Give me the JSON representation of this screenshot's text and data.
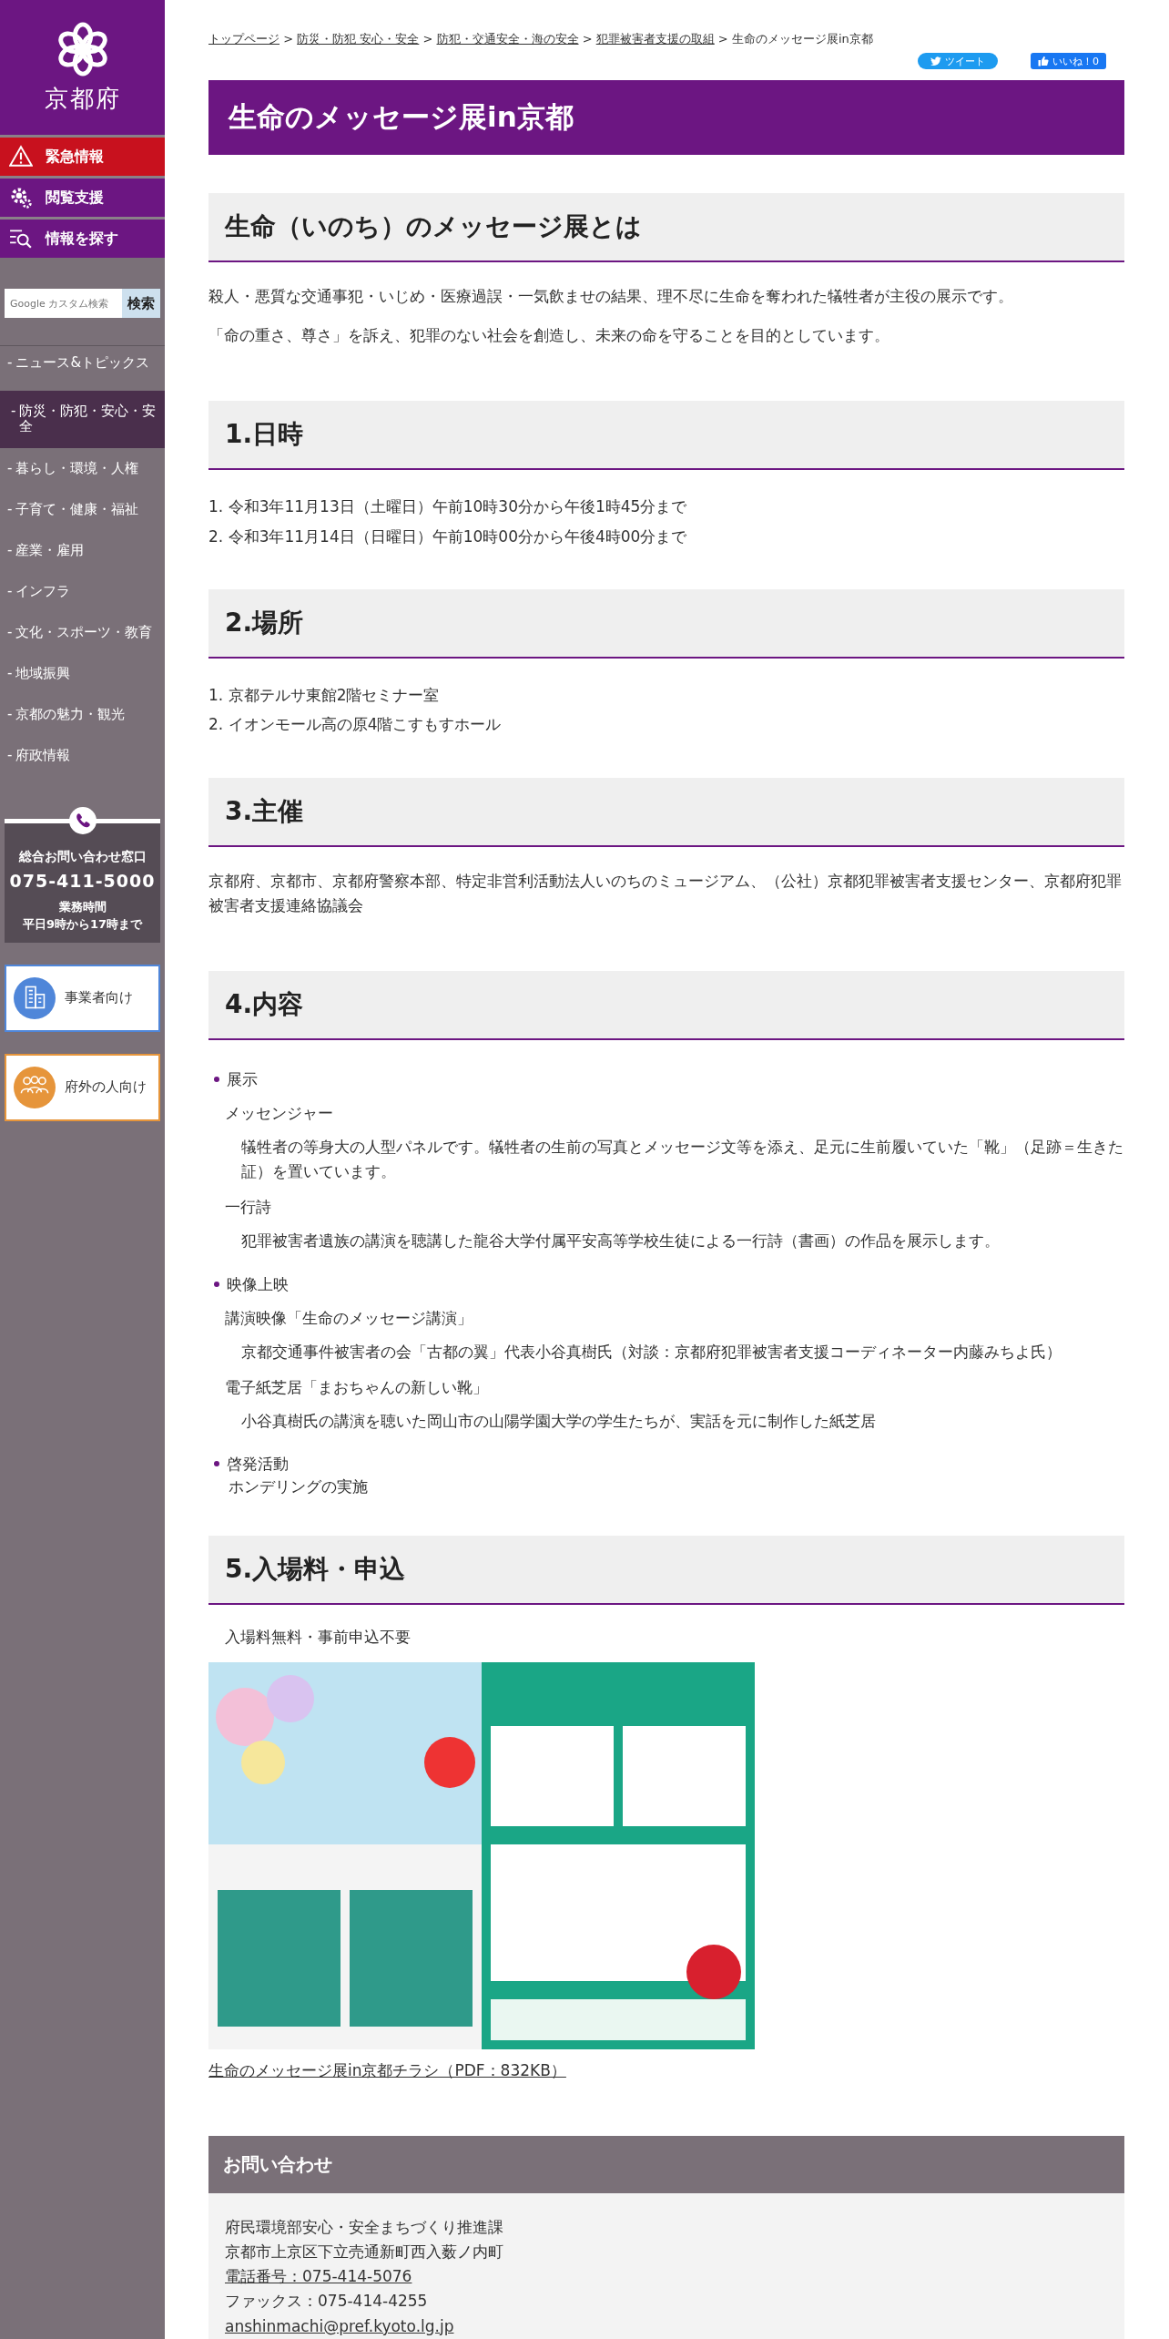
{
  "logo": {
    "text": "京都府"
  },
  "top_menu": [
    {
      "label": "緊急情報",
      "kind": "alert"
    },
    {
      "label": "閲覧支援",
      "kind": "gear"
    },
    {
      "label": "情報を探す",
      "kind": "search"
    }
  ],
  "search": {
    "placeholder": "Google カスタム検索",
    "button": "検索"
  },
  "nav": [
    {
      "label": "ニュース&トピックス",
      "selected": false
    },
    {
      "label": "防災・防犯・安心・安全",
      "selected": true
    },
    {
      "label": "暮らし・環境・人権",
      "selected": false
    },
    {
      "label": "子育て・健康・福祉",
      "selected": false
    },
    {
      "label": "産業・雇用",
      "selected": false
    },
    {
      "label": "インフラ",
      "selected": false
    },
    {
      "label": "文化・スポーツ・教育",
      "selected": false
    },
    {
      "label": "地域振興",
      "selected": false
    },
    {
      "label": "京都の魅力・観光",
      "selected": false
    },
    {
      "label": "府政情報",
      "selected": false
    }
  ],
  "nav_dash": "-",
  "contact_box": {
    "title": "総合お問い合わせ窓口",
    "phone": "075-411-5000",
    "hours_label": "業務時間",
    "hours": "平日9時から17時まで"
  },
  "audience_links": [
    {
      "label": "事業者向け",
      "kind": "business",
      "color": "#4f86d9"
    },
    {
      "label": "府外の人向け",
      "kind": "people",
      "color": "#e6953b"
    }
  ],
  "breadcrumb": {
    "separator": ">",
    "links": [
      "トップページ",
      "防災・防犯 安心・安全",
      "防犯・交通安全・海の安全",
      "犯罪被害者支援の取組"
    ],
    "current": "生命のメッセージ展in京都"
  },
  "social": [
    {
      "label": "ツイート",
      "kind": "tweet"
    },
    {
      "label": "いいね！0",
      "kind": "like"
    }
  ],
  "page_title": "生命のメッセージ展in京都",
  "sections": [
    {
      "heading": "生命（いのち）のメッセージ展とは",
      "blocks": [
        {
          "kind": "paragraph",
          "text": "殺人・悪質な交通事犯・いじめ・医療過誤・一気飲ませの結果、理不尽に生命を奪われた犠牲者が主役の展示です。"
        },
        {
          "kind": "paragraph",
          "text": "「命の重さ、尊さ」を訴え、犯罪のない社会を創造し、未来の命を守ることを目的としています。"
        }
      ]
    },
    {
      "heading": "1.日時",
      "blocks": [
        {
          "kind": "numbered",
          "items": [
            {
              "number": "1.",
              "text": "令和3年11月13日（土曜日）午前10時30分から午後1時45分まで"
            },
            {
              "number": "2.",
              "text": "令和3年11月14日（日曜日）午前10時00分から午後4時00分まで"
            }
          ]
        }
      ]
    },
    {
      "heading": "2.場所",
      "blocks": [
        {
          "kind": "numbered",
          "items": [
            {
              "number": "1.",
              "text": "京都テルサ東館2階セミナー室"
            },
            {
              "number": "2.",
              "text": "イオンモール高の原4階こすもすホール"
            }
          ]
        }
      ]
    },
    {
      "heading": "3.主催",
      "blocks": [
        {
          "kind": "paragraph",
          "text": "京都府、京都市、京都府警察本部、特定非営利活動法人いのちのミュージアム、（公社）京都犯罪被害者支援センター、京都府犯罪被害者支援連絡協議会"
        }
      ]
    },
    {
      "heading": "4.内容",
      "blocks": [
        {
          "kind": "bullets",
          "items": [
            {
              "label": "展示",
              "children": [
                {
                  "title": "メッセンジャー",
                  "text": "犠牲者の等身大の人型パネルです。犠牲者の生前の写真とメッセージ文等を添え、足元に生前履いていた「靴」（足跡＝生きた証）を置いています。"
                },
                {
                  "title": "一行詩",
                  "text": "犯罪被害者遺族の講演を聴講した龍谷大学付属平安高等学校生徒による一行詩（書画）の作品を展示します。"
                }
              ]
            },
            {
              "label": "映像上映",
              "children": [
                {
                  "title": "講演映像「生命のメッセージ講演」",
                  "text": "京都交通事件被害者の会「古都の翼」代表小谷真樹氏（対談：京都府犯罪被害者支援コーディネーター内藤みちよ氏）"
                },
                {
                  "title": "電子紙芝居「まおちゃんの新しい靴」",
                  "text": "小谷真樹氏の講演を聴いた岡山市の山陽学園大学の学生たちが、実話を元に制作した紙芝居"
                }
              ]
            },
            {
              "label": "啓発活動",
              "note": "ホンデリングの実施"
            }
          ]
        }
      ]
    },
    {
      "heading": "5.入場料・申込",
      "blocks": [
        {
          "kind": "indented",
          "text": "入場料無料・事前申込不要"
        },
        {
          "kind": "picture"
        },
        {
          "kind": "link",
          "text": "生命のメッセージ展in京都チラシ（PDF：832KB）"
        }
      ]
    }
  ],
  "inquiry": {
    "title": "お問い合わせ",
    "lines": [
      {
        "kind": "text",
        "text": "府民環境部安心・安全まちづくり推進課"
      },
      {
        "kind": "text",
        "text": "京都市上京区下立売通新町西入薮ノ内町"
      },
      {
        "kind": "link",
        "text": "電話番号：075-414-5076"
      },
      {
        "kind": "text",
        "text": "ファックス：075-414-4255"
      },
      {
        "kind": "link",
        "text": "anshinmachi@pref.kyoto.lg.jp"
      }
    ]
  }
}
